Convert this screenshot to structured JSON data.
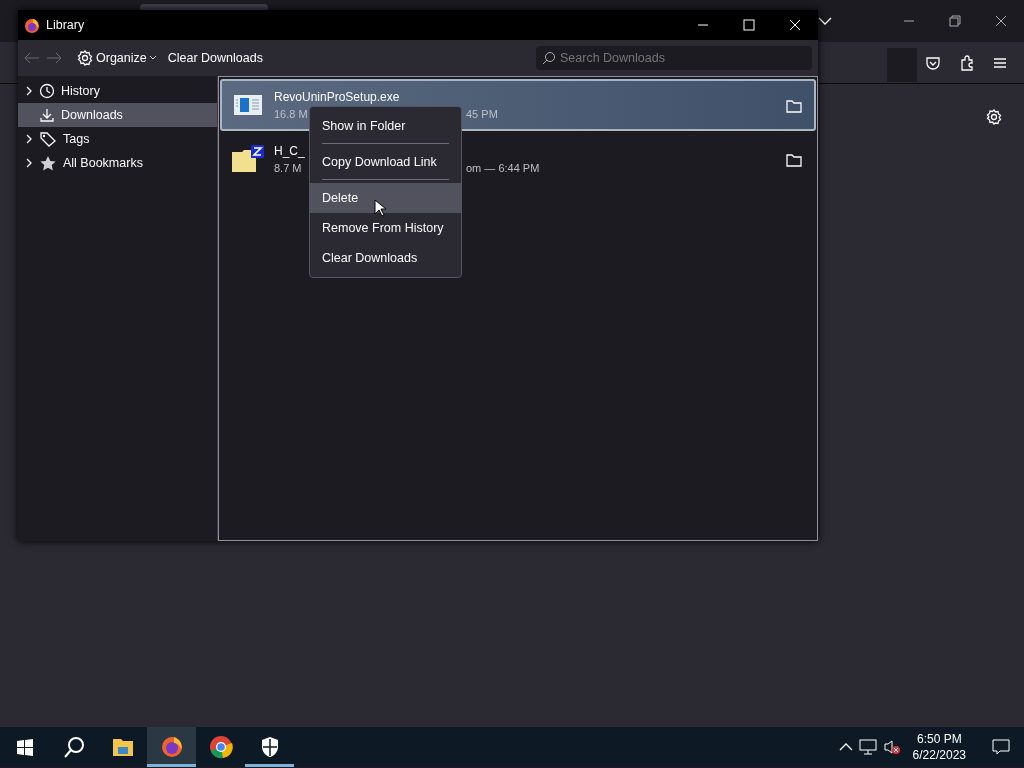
{
  "library": {
    "title": "Library",
    "toolbar": {
      "organize": "Organize",
      "clear": "Clear Downloads",
      "search_placeholder": "Search Downloads"
    },
    "sidebar": [
      {
        "kind": "history",
        "label": "History",
        "expandable": true,
        "selected": false
      },
      {
        "kind": "downloads",
        "label": "Downloads",
        "expandable": false,
        "selected": true
      },
      {
        "kind": "tags",
        "label": "Tags",
        "expandable": true,
        "selected": false
      },
      {
        "kind": "bookmarks",
        "label": "All Bookmarks",
        "expandable": true,
        "selected": false
      }
    ],
    "downloads": [
      {
        "kind": "exe",
        "title": "RevoUninProSetup.exe",
        "detail_left": "16.8 M",
        "detail_right": "45 PM",
        "selected": true
      },
      {
        "kind": "zip",
        "title": "H_C_",
        "detail_left": "8.7 M",
        "detail_right": "om — 6:44 PM",
        "selected": false
      }
    ],
    "context_menu": [
      {
        "label": "Show in Folder",
        "highlighted": false,
        "separator_after": true
      },
      {
        "label": "Copy Download Link",
        "highlighted": false,
        "separator_after": true
      },
      {
        "label": "Delete",
        "highlighted": true,
        "separator_after": false
      },
      {
        "label": "Remove From History",
        "highlighted": false,
        "separator_after": false
      },
      {
        "label": "Clear Downloads",
        "highlighted": false,
        "separator_after": false
      }
    ]
  },
  "taskbar": {
    "apps": [
      {
        "kind": "start",
        "active": false,
        "running": false
      },
      {
        "kind": "search",
        "active": false,
        "running": false
      },
      {
        "kind": "explorer",
        "active": false,
        "running": false
      },
      {
        "kind": "firefox",
        "active": true,
        "running": true
      },
      {
        "kind": "chrome",
        "active": false,
        "running": false
      },
      {
        "kind": "security",
        "active": false,
        "running": true
      }
    ],
    "time": "6:50 PM",
    "date": "6/22/2023"
  }
}
